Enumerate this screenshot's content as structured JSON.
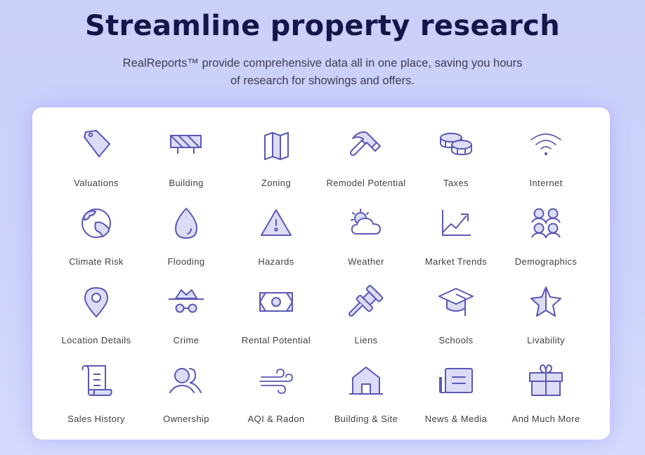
{
  "header": {
    "title": "Streamline property research",
    "subtitle": "RealReports™ provide comprehensive data all in one place, saving you hours of research for showings and offers."
  },
  "colors": {
    "accent": "#5b58b5",
    "icon_fill": "#dcdcf7",
    "title": "#15154a",
    "background": "#cbd0fb"
  },
  "features": [
    {
      "label": "Valuations",
      "icon": "price-tag-icon"
    },
    {
      "label": "Building",
      "icon": "barricade-icon"
    },
    {
      "label": "Zoning",
      "icon": "folded-map-icon"
    },
    {
      "label": "Remodel Potential",
      "icon": "hammer-icon"
    },
    {
      "label": "Taxes",
      "icon": "coins-icon"
    },
    {
      "label": "Internet",
      "icon": "wifi-icon"
    },
    {
      "label": "Climate Risk",
      "icon": "globe-icon"
    },
    {
      "label": "Flooding",
      "icon": "water-drop-icon"
    },
    {
      "label": "Hazards",
      "icon": "warning-triangle-icon"
    },
    {
      "label": "Weather",
      "icon": "sun-cloud-icon"
    },
    {
      "label": "Market Trends",
      "icon": "trend-chart-icon"
    },
    {
      "label": "Demographics",
      "icon": "people-group-icon"
    },
    {
      "label": "Location Details",
      "icon": "map-pin-icon"
    },
    {
      "label": "Crime",
      "icon": "incognito-icon"
    },
    {
      "label": "Rental Potential",
      "icon": "money-bill-icon"
    },
    {
      "label": "Liens",
      "icon": "gavel-icon"
    },
    {
      "label": "Schools",
      "icon": "graduation-cap-icon"
    },
    {
      "label": "Livability",
      "icon": "star-icon"
    },
    {
      "label": "Sales History",
      "icon": "scroll-icon"
    },
    {
      "label": "Ownership",
      "icon": "users-icon"
    },
    {
      "label": "AQI & Radon",
      "icon": "wind-icon"
    },
    {
      "label": "Building & Site",
      "icon": "house-icon"
    },
    {
      "label": "News & Media",
      "icon": "newspaper-icon"
    },
    {
      "label": "And Much More",
      "icon": "gift-icon"
    }
  ]
}
